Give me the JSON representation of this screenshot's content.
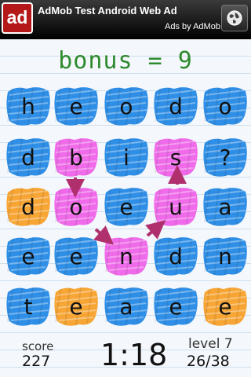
{
  "ad": {
    "logo_text": "ad",
    "title": "AdMob Test Android Web Ad",
    "credit": "Ads by AdMob",
    "icon": "globe-icon"
  },
  "bonus_text": "bonus = 9",
  "colors": {
    "blue": "#2f8fe6",
    "pink": "#f06bea",
    "orange": "#f7a534",
    "arrow": "#b0306e"
  },
  "grid": [
    [
      {
        "l": "h",
        "c": "blue"
      },
      {
        "l": "e",
        "c": "blue"
      },
      {
        "l": "o",
        "c": "blue"
      },
      {
        "l": "d",
        "c": "blue"
      },
      {
        "l": "o",
        "c": "blue"
      }
    ],
    [
      {
        "l": "d",
        "c": "blue"
      },
      {
        "l": "b",
        "c": "pink"
      },
      {
        "l": "i",
        "c": "blue"
      },
      {
        "l": "s",
        "c": "pink"
      },
      {
        "l": "?",
        "c": "blue"
      }
    ],
    [
      {
        "l": "d",
        "c": "orange"
      },
      {
        "l": "o",
        "c": "pink"
      },
      {
        "l": "e",
        "c": "blue"
      },
      {
        "l": "u",
        "c": "pink"
      },
      {
        "l": "a",
        "c": "blue"
      }
    ],
    [
      {
        "l": "e",
        "c": "blue"
      },
      {
        "l": "e",
        "c": "blue"
      },
      {
        "l": "n",
        "c": "pink"
      },
      {
        "l": "d",
        "c": "blue"
      },
      {
        "l": "n",
        "c": "blue"
      }
    ],
    [
      {
        "l": "t",
        "c": "blue"
      },
      {
        "l": "e",
        "c": "orange"
      },
      {
        "l": "a",
        "c": "blue"
      },
      {
        "l": "e",
        "c": "blue"
      },
      {
        "l": "e",
        "c": "orange"
      }
    ]
  ],
  "footer": {
    "score_label": "score",
    "score_value": "227",
    "timer": "1:18",
    "level_label": "level 7",
    "level_progress": "26/38"
  }
}
